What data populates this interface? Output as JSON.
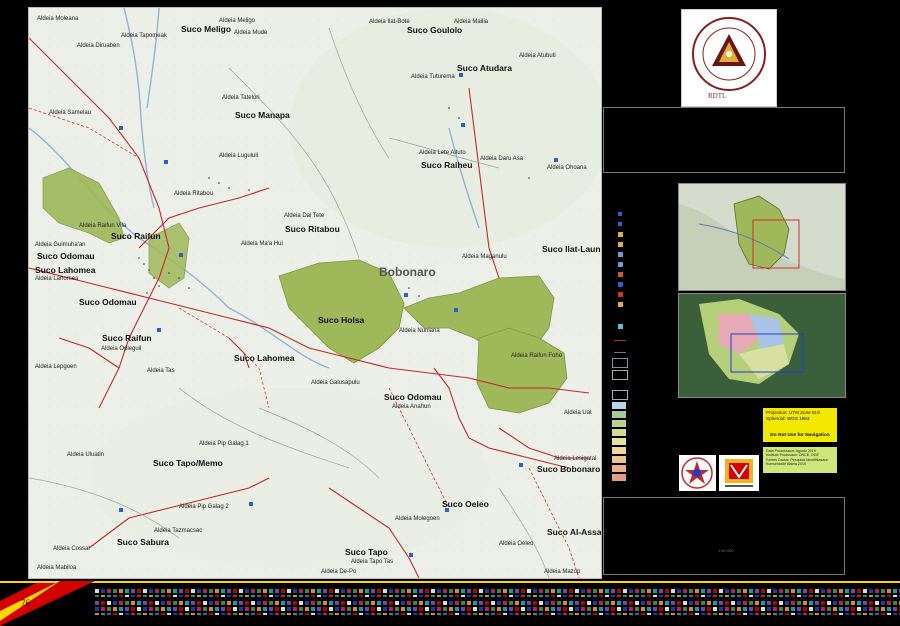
{
  "page_number": "76",
  "seal": {
    "text": "REPUBLICA DEMOCRATICA DE TIMOR-LESTE",
    "monogram": "RDTL"
  },
  "town_label": "Bobonaro",
  "suco_labels": [
    "Suco Meligo",
    "Suco Goulolo",
    "Suco Atudara",
    "Suco Manapa",
    "Suco Raiheu",
    "Suco Ritabou",
    "Suco Ilat-Laun",
    "Suco Raifun",
    "Suco Odomau",
    "Suco Lahomea",
    "Suco Odomau",
    "Suco Holsa",
    "Suco Raifun",
    "Suco Lahomea",
    "Suco Odomau",
    "Suco Tapo/Memo",
    "Suco Bobonaro",
    "Suco Oeleo",
    "Suco Sabura",
    "Suco Al-Assa",
    "Suco Tapo"
  ],
  "aldeia_labels": [
    "Aldeia Moleana",
    "Aldeia Meligo",
    "Aldeia Mude",
    "Aldeia Tapomeak",
    "Aldeia Diruaben",
    "Aldeia Ilat-Bote",
    "Aldeia Mailia",
    "Aldeia Atubuti",
    "Aldeia Tuturema",
    "Aldeia Samelau",
    "Aldeia Tatelori",
    "Aldeia Lete Aituto",
    "Aldeia Daru Asa",
    "Aldeia Ohoana",
    "Aldeia Lugululi",
    "Aldeia Dai Tete",
    "Aldeia Ritabou",
    "Aldeia Ma'a Hui",
    "Aldeia Maganulu",
    "Aldeia Raifun Vila",
    "Aldeia Guimuha'an",
    "Aldeia Lahomea",
    "Aldeia Nunlana",
    "Aldeia Raifun Foho",
    "Aldeia Opleguil",
    "Aldeia Lepgoen",
    "Aldeia Tas",
    "Aldeia Galusapulu",
    "Aldeia Anahun",
    "Aldeia Uat",
    "Aldeia Pip Galag 1",
    "Aldeia Pip Galag 2",
    "Aldeia Uluatin",
    "Aldeia Lesigatal",
    "Aldeia Tazmacsac",
    "Aldeia Cossal",
    "Aldeia Molegoen",
    "Aldeia Tapo Tas",
    "Aldeia Mabiloa",
    "Aldeia De-Po",
    "Aldeia Mazop",
    "Aldeia Oeleo"
  ],
  "info_panel": {
    "projection": "Projection: UTM Zone 51S",
    "spheroid": "Spheroid: WGS 1984",
    "warning": "Do Not Use for Navigation",
    "source_lines": [
      "Data Produksaun: Agosto 2019",
      "Instituto Produsaun: DNCE, DGE",
      "Fontes Dadus: Pesquisa Identifikasaun",
      "Komunidade Aldeia 2019"
    ],
    "scale": "1:50,000"
  },
  "colors": {
    "background": "#000000",
    "map_base": "#eef1ea",
    "suco_fill": "#9fb85a",
    "road": "#c62828",
    "river": "#8fb4d9",
    "flag_red": "#d50000",
    "flag_yellow": "#ffd600",
    "highlight_box": "#f2e800"
  },
  "icons": [
    "school-icon",
    "church-icon",
    "health-post-icon",
    "water-point-icon",
    "market-icon",
    "office-icon"
  ]
}
